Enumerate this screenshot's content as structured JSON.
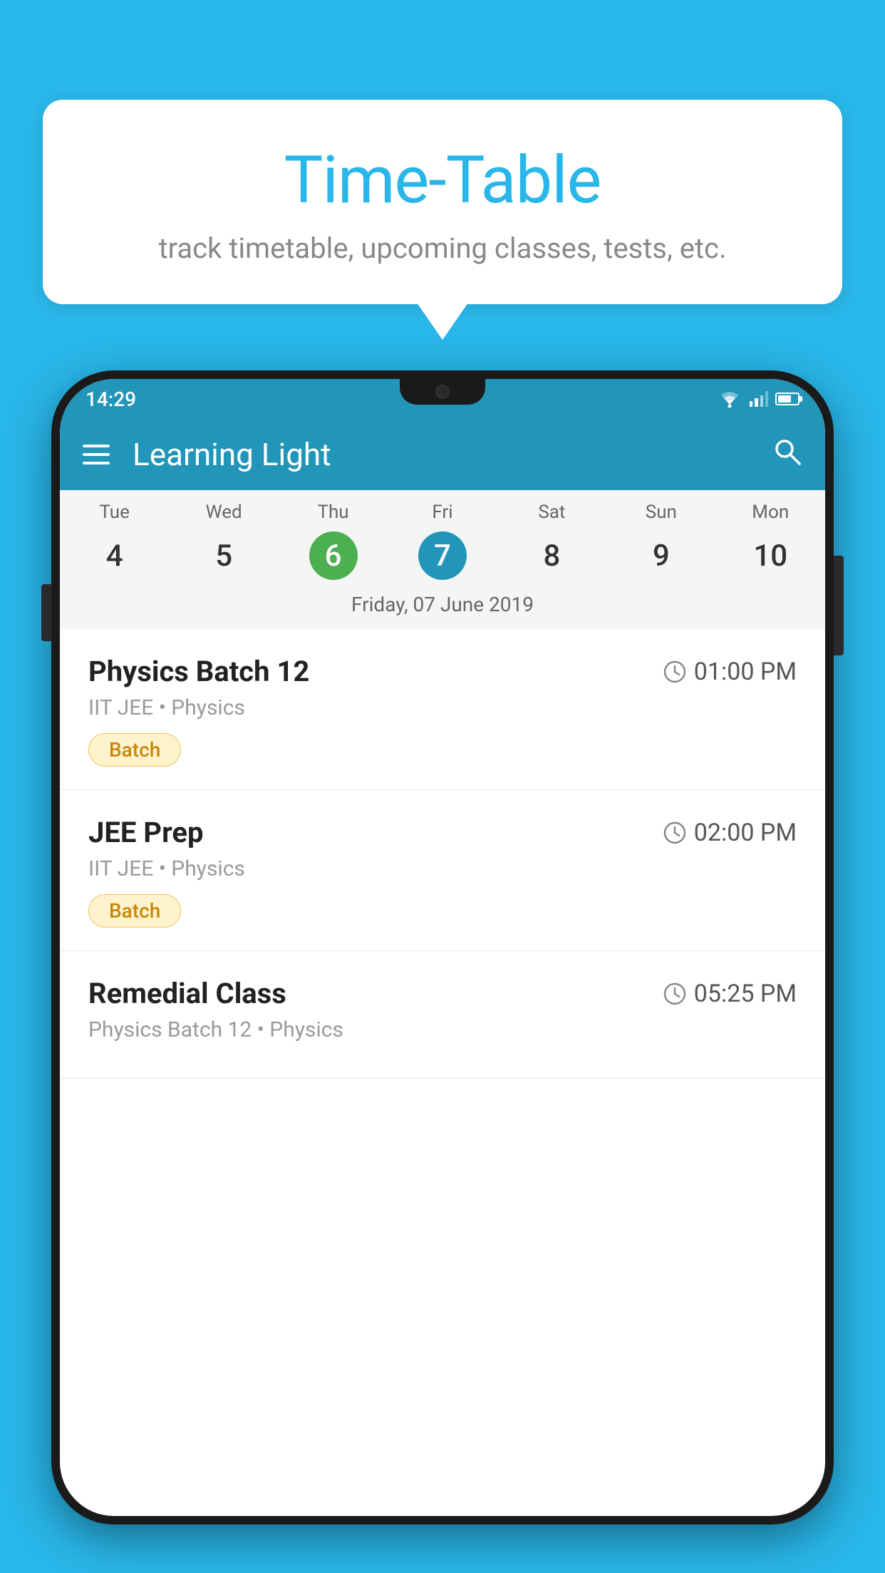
{
  "background_color": "#29b6e8",
  "bubble": {
    "title": "Time-Table",
    "subtitle": "track timetable, upcoming classes, tests, etc."
  },
  "phone": {
    "status_bar": {
      "time": "14:29"
    },
    "app_bar": {
      "title": "Learning Light"
    },
    "calendar": {
      "days": [
        {
          "name": "Tue",
          "num": "4",
          "state": "normal"
        },
        {
          "name": "Wed",
          "num": "5",
          "state": "normal"
        },
        {
          "name": "Thu",
          "num": "6",
          "state": "today"
        },
        {
          "name": "Fri",
          "num": "7",
          "state": "selected"
        },
        {
          "name": "Sat",
          "num": "8",
          "state": "normal"
        },
        {
          "name": "Sun",
          "num": "9",
          "state": "normal"
        },
        {
          "name": "Mon",
          "num": "10",
          "state": "normal"
        }
      ],
      "selected_date_label": "Friday, 07 June 2019"
    },
    "schedule": [
      {
        "title": "Physics Batch 12",
        "time": "01:00 PM",
        "subtitle": "IIT JEE • Physics",
        "badge": "Batch"
      },
      {
        "title": "JEE Prep",
        "time": "02:00 PM",
        "subtitle": "IIT JEE • Physics",
        "badge": "Batch"
      },
      {
        "title": "Remedial Class",
        "time": "05:25 PM",
        "subtitle": "Physics Batch 12 • Physics",
        "badge": null
      }
    ]
  }
}
